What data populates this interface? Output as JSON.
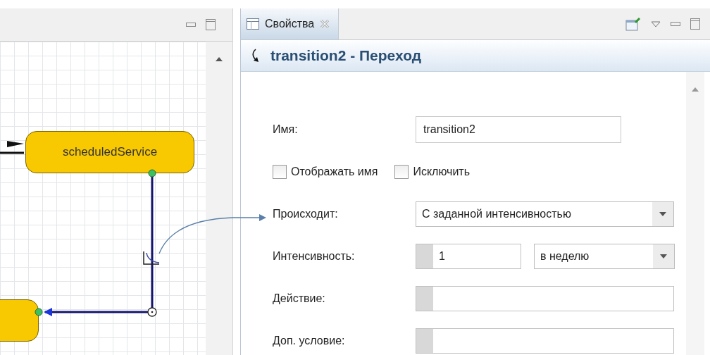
{
  "diagram_panel": {
    "states": [
      {
        "name": "scheduledService"
      }
    ]
  },
  "properties_panel": {
    "tab": {
      "label": "Свойства",
      "selected": true
    },
    "heading": "transition2 - Переход",
    "rows": [
      {
        "kind": "text",
        "label": "Имя:",
        "value": "transition2"
      },
      {
        "kind": "checks",
        "items": [
          {
            "label": "Отображать имя",
            "checked": false
          },
          {
            "label": "Исключить",
            "checked": false
          }
        ]
      },
      {
        "kind": "dropdown",
        "label": "Происходит:",
        "value": "С заданной интенсивностью"
      },
      {
        "kind": "rate",
        "label": "Интенсивность:",
        "value": "1",
        "unit": "в неделю"
      },
      {
        "kind": "code",
        "label": "Действие:"
      },
      {
        "kind": "code",
        "label": "Доп. условие:"
      }
    ]
  }
}
